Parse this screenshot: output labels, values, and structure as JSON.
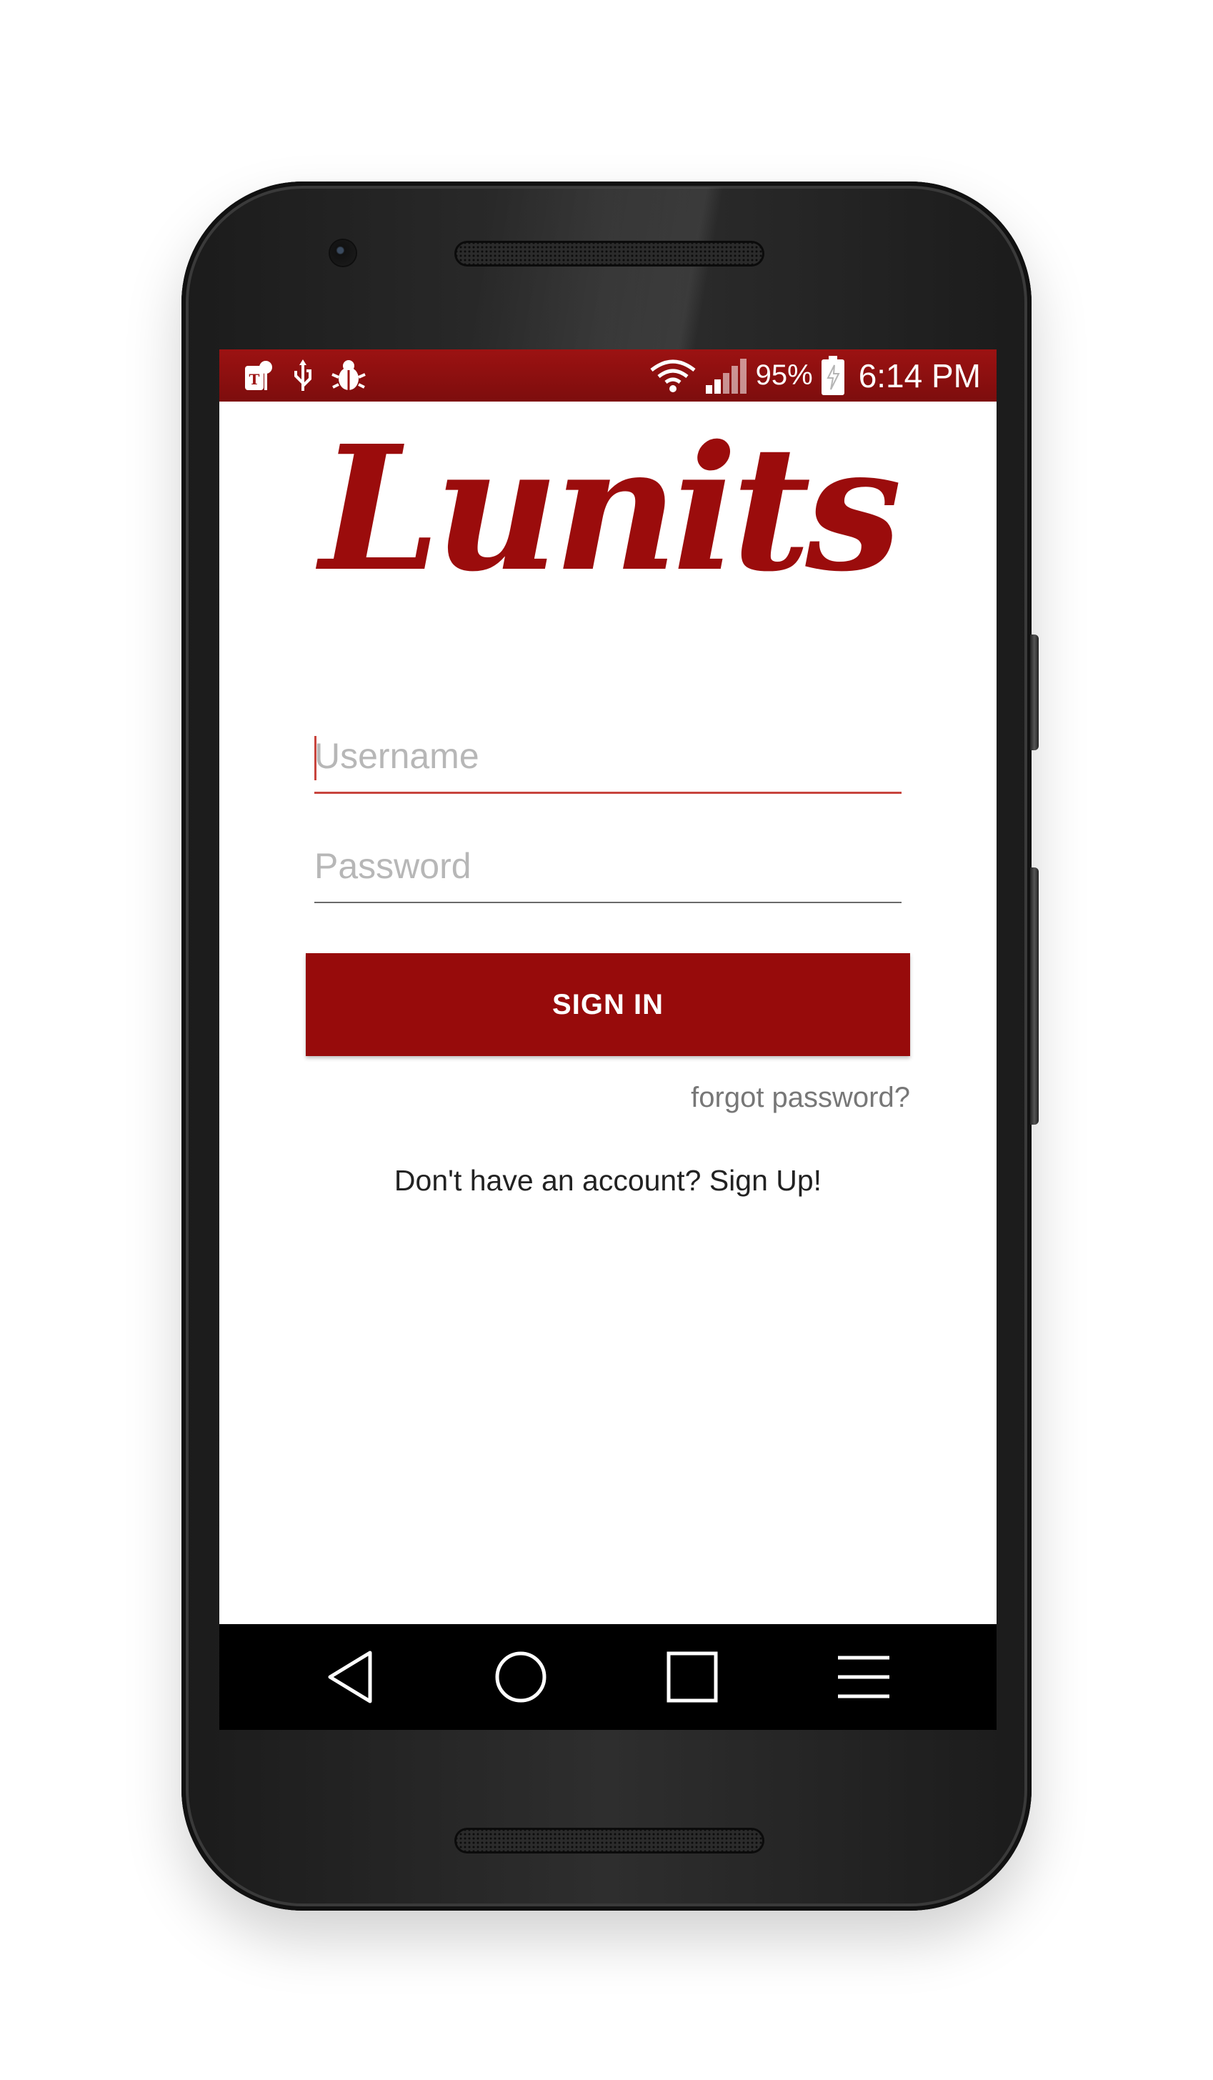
{
  "status_bar": {
    "left_icons": [
      "t-mobile-icon",
      "usb-icon",
      "bug-icon"
    ],
    "battery_percent": "95%",
    "time": "6:14 PM",
    "background_color": "#8e0f0f"
  },
  "app": {
    "logo_text": "Lunits",
    "brand_color": "#970b0b"
  },
  "login": {
    "username_placeholder": "Username",
    "password_placeholder": "Password",
    "sign_in_label": "SIGN IN",
    "forgot_password_label": "forgot password?",
    "sign_up_prompt": "Don't have an account? Sign Up!"
  },
  "nav_bar": {
    "buttons": [
      "back-icon",
      "home-icon",
      "recents-icon",
      "menu-icon"
    ]
  }
}
